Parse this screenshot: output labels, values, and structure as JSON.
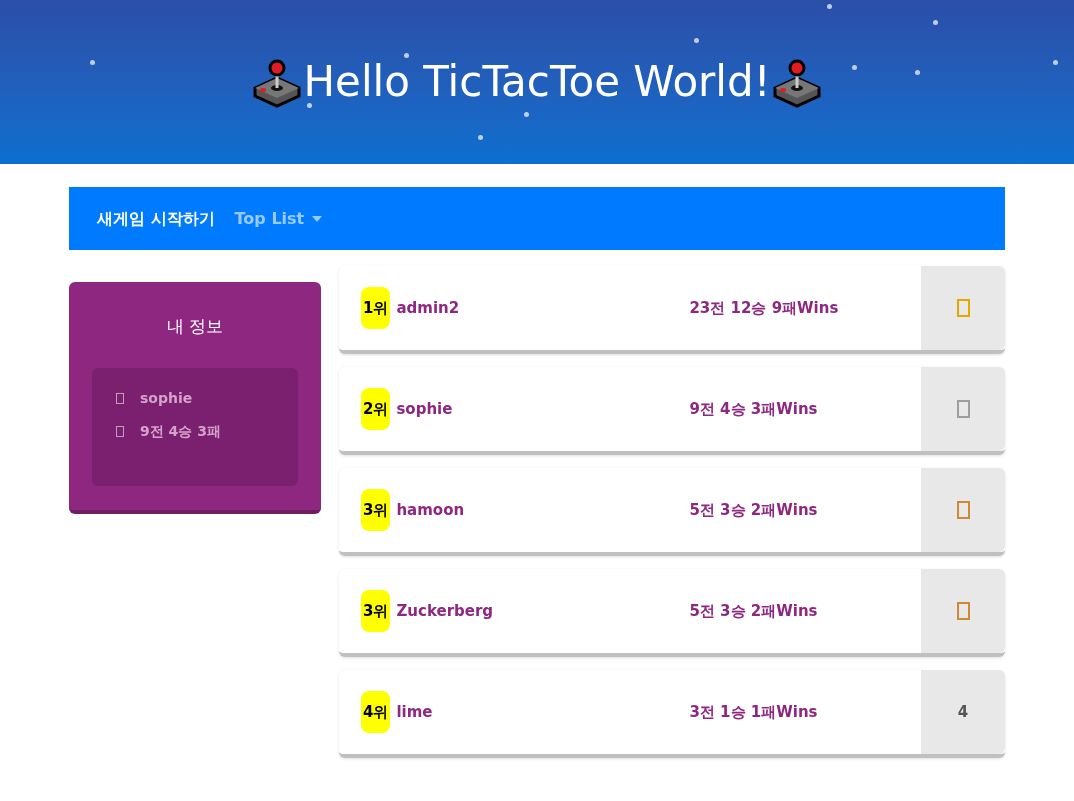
{
  "header": {
    "title": "Hello TicTacToe World!"
  },
  "navbar": {
    "items": [
      {
        "label": "새게임 시작하기",
        "kind": "link"
      },
      {
        "label": "Top List",
        "kind": "dropdown"
      }
    ]
  },
  "my_info": {
    "title": "내 정보",
    "username": "sophie",
    "record": "9전 4승 3패"
  },
  "ranking": [
    {
      "rank": "1위",
      "name": "admin2",
      "record": "23전 12승 9패Wins",
      "badge": {
        "kind": "medal",
        "color": "#e6a800"
      }
    },
    {
      "rank": "2위",
      "name": "sophie",
      "record": "9전 4승 3패Wins",
      "badge": {
        "kind": "medal",
        "color": "#9e9e9e"
      }
    },
    {
      "rank": "3위",
      "name": "hamoon",
      "record": "5전 3승 2패Wins",
      "badge": {
        "kind": "medal",
        "color": "#cd8a34"
      }
    },
    {
      "rank": "3위",
      "name": "Zuckerberg",
      "record": "5전 3승 2패Wins",
      "badge": {
        "kind": "medal",
        "color": "#cd8a34"
      }
    },
    {
      "rank": "4위",
      "name": "lime",
      "record": "3전 1승 1패Wins",
      "badge": {
        "kind": "number",
        "text": "4"
      }
    }
  ]
}
